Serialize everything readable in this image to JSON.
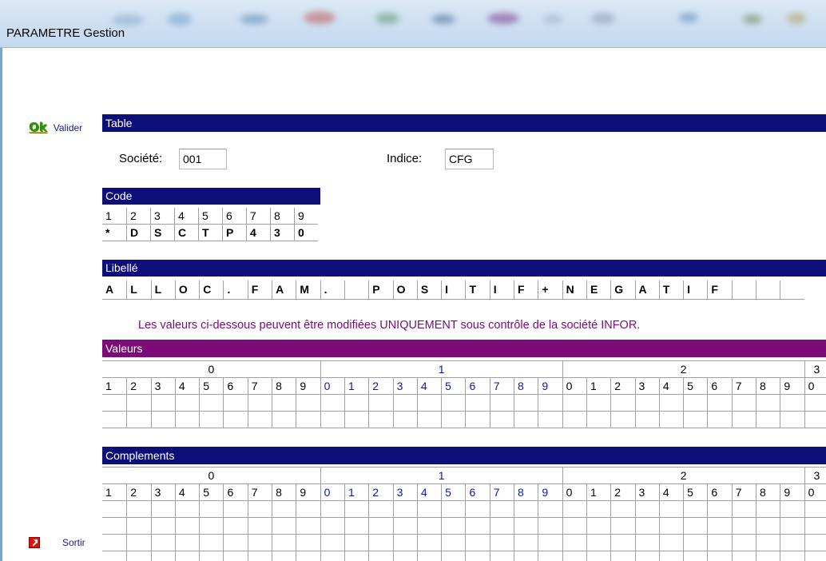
{
  "window": {
    "title": "PARAMETRE Gestion"
  },
  "actions": {
    "ok_icon": "Ok",
    "valider": "Valider",
    "sortir": "Sortir"
  },
  "table_section": {
    "header": "Table",
    "societe_label": "Société:",
    "societe_value": "001",
    "indice_label": "Indice:",
    "indice_value": "CFG"
  },
  "code_section": {
    "header": "Code",
    "positions": [
      "1",
      "2",
      "3",
      "4",
      "5",
      "6",
      "7",
      "8",
      "9"
    ],
    "chars": [
      "*",
      "D",
      "S",
      "C",
      "T",
      "P",
      "4",
      "3",
      "0"
    ]
  },
  "libelle_section": {
    "header": "Libellé",
    "chars": [
      "A",
      "L",
      "L",
      "O",
      "C",
      ".",
      "F",
      "A",
      "M",
      ".",
      "",
      "P",
      "O",
      "S",
      "I",
      "T",
      "I",
      "F",
      "+",
      "N",
      "E",
      "G",
      "A",
      "T",
      "I",
      "F",
      "",
      "",
      ""
    ]
  },
  "notice": "Les valeurs ci-dessous peuvent être modifiées UNIQUEMENT sous contrôle de la société INFOR.",
  "valeurs_section": {
    "header": "Valeurs",
    "groups": [
      "0",
      "1",
      "2",
      "3"
    ],
    "positions": [
      "1",
      "2",
      "3",
      "4",
      "5",
      "6",
      "7",
      "8",
      "9",
      "0",
      "1",
      "2",
      "3",
      "4",
      "5",
      "6",
      "7",
      "8",
      "9",
      "0",
      "1",
      "2",
      "3",
      "4",
      "5",
      "6",
      "7",
      "8",
      "9",
      "0"
    ]
  },
  "complements_section": {
    "header": "Complements",
    "groups": [
      "0",
      "1",
      "2",
      "3"
    ],
    "positions": [
      "1",
      "2",
      "3",
      "4",
      "5",
      "6",
      "7",
      "8",
      "9",
      "0",
      "1",
      "2",
      "3",
      "4",
      "5",
      "6",
      "7",
      "8",
      "9",
      "0",
      "1",
      "2",
      "3",
      "4",
      "5",
      "6",
      "7",
      "8",
      "9",
      "0"
    ]
  },
  "colors": {
    "navy_header": "#0e0e78",
    "purple_header": "#7c0a78",
    "notice_text": "#7a0a78",
    "ok_green": "#1a9a10",
    "blue_digits": "#0b19a8"
  }
}
